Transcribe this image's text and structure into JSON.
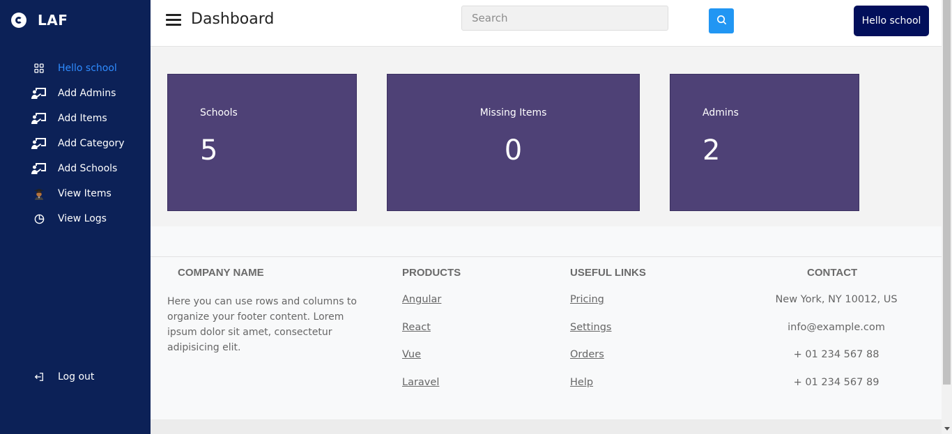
{
  "brand": {
    "name": "LAF"
  },
  "sidebar": {
    "items": [
      {
        "label": "Hello school",
        "icon": "grid-icon",
        "active": true
      },
      {
        "label": "Add Admins",
        "icon": "presentation-icon"
      },
      {
        "label": "Add Items",
        "icon": "presentation-icon"
      },
      {
        "label": "Add Category",
        "icon": "presentation-icon"
      },
      {
        "label": "Add Schools",
        "icon": "presentation-icon"
      },
      {
        "label": "View Items",
        "icon": "graduate-icon"
      },
      {
        "label": "View Logs",
        "icon": "pie-chart-icon"
      }
    ],
    "logout_label": "Log out"
  },
  "header": {
    "title": "Dashboard",
    "search_placeholder": "Search",
    "search_value": "",
    "user_button": "Hello school"
  },
  "cards": [
    {
      "label": "Schools",
      "value": "5"
    },
    {
      "label": "Missing Items",
      "value": "0"
    },
    {
      "label": "Admins",
      "value": "2"
    }
  ],
  "footer": {
    "company": {
      "heading": "COMPANY NAME",
      "text": "Here you can use rows and columns to organize your footer content. Lorem ipsum dolor sit amet, consectetur adipisicing elit."
    },
    "products": {
      "heading": "PRODUCTS",
      "links": [
        "Angular",
        "React",
        "Vue",
        "Laravel"
      ]
    },
    "useful_links": {
      "heading": "USEFUL LINKS",
      "links": [
        "Pricing",
        "Settings",
        "Orders",
        "Help"
      ]
    },
    "contact": {
      "heading": "CONTACT",
      "lines": [
        "New York, NY 10012, US",
        "info@example.com",
        "+ 01 234 567 88",
        "+ 01 234 567 89"
      ]
    }
  },
  "colors": {
    "sidebar_bg": "#0c2157",
    "active_link": "#2f8cff",
    "card_bg": "#4e4176",
    "search_button": "#2196f3",
    "user_button": "#020f5b"
  }
}
